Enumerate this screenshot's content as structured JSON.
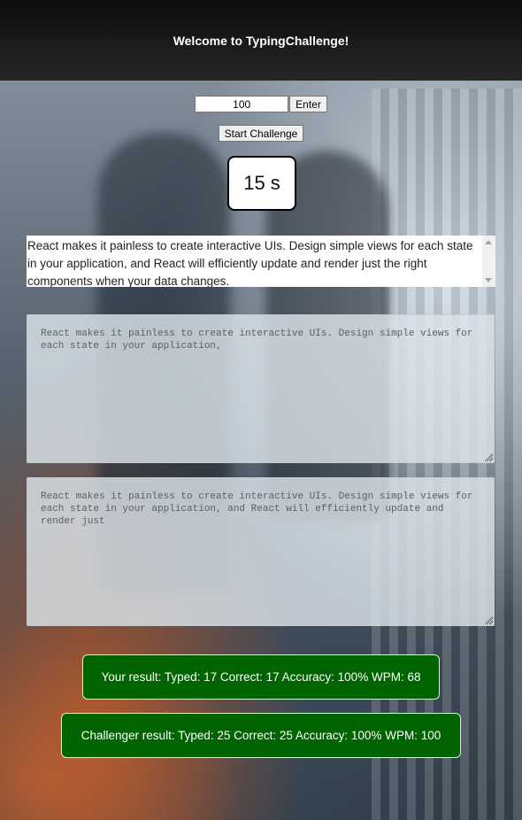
{
  "header": {
    "title": "Welcome to TypingChallenge!"
  },
  "controls": {
    "count_value": "100",
    "enter_label": "Enter",
    "start_label": "Start Challenge"
  },
  "timer": {
    "display": "15 s"
  },
  "passage": {
    "text": "React makes it painless to create interactive UIs. Design simple views for each state in your application, and React will efficiently update and render just the right components when your data changes."
  },
  "user_input": {
    "value": "React makes it painless to create interactive UIs. Design simple views for each state in your application,"
  },
  "challenger_input": {
    "value": "React makes it painless to create interactive UIs. Design simple views for each state in your application, and React will efficiently update and render just"
  },
  "results": {
    "user": "Your result: Typed: 17 Correct: 17 Accuracy: 100% WPM: 68",
    "challenger": "Challenger result: Typed: 25 Correct: 25 Accuracy: 100% WPM: 100"
  },
  "colors": {
    "header_bg": "#1a1a1a",
    "result_bg": "#006400"
  }
}
